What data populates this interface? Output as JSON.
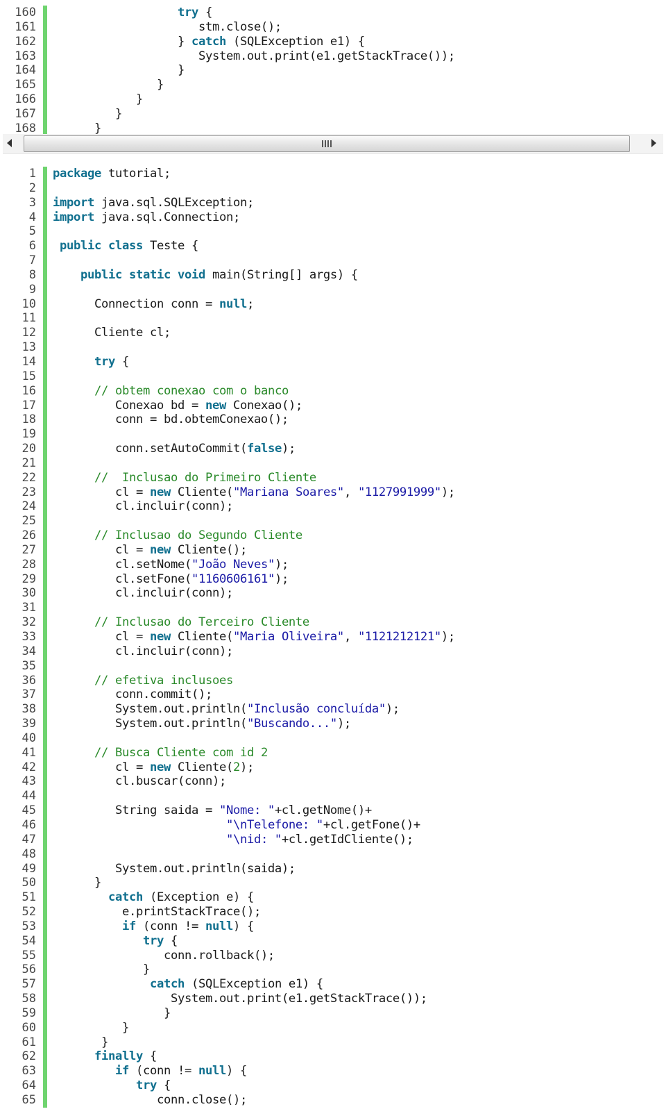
{
  "top_block": {
    "lines": [
      {
        "n": "160",
        "indent": "                  ",
        "tokens": [
          {
            "t": "try",
            "c": "kw"
          },
          {
            "t": " {",
            "c": ""
          }
        ]
      },
      {
        "n": "161",
        "indent": "                     ",
        "tokens": [
          {
            "t": "stm.close();",
            "c": ""
          }
        ]
      },
      {
        "n": "162",
        "indent": "                  ",
        "tokens": [
          {
            "t": "} ",
            "c": ""
          },
          {
            "t": "catch",
            "c": "kw"
          },
          {
            "t": " (SQLException e1) {",
            "c": ""
          }
        ]
      },
      {
        "n": "163",
        "indent": "                     ",
        "tokens": [
          {
            "t": "System.out.print(e1.getStackTrace());",
            "c": ""
          }
        ]
      },
      {
        "n": "164",
        "indent": "                  ",
        "tokens": [
          {
            "t": "}",
            "c": ""
          }
        ]
      },
      {
        "n": "165",
        "indent": "               ",
        "tokens": [
          {
            "t": "}",
            "c": ""
          }
        ]
      },
      {
        "n": "166",
        "indent": "            ",
        "tokens": [
          {
            "t": "}",
            "c": ""
          }
        ]
      },
      {
        "n": "167",
        "indent": "         ",
        "tokens": [
          {
            "t": "}",
            "c": ""
          }
        ]
      },
      {
        "n": "168",
        "indent": "      ",
        "tokens": [
          {
            "t": "}",
            "c": ""
          }
        ]
      }
    ]
  },
  "scrollbar": {
    "left_icon": "arrow-left-icon",
    "right_icon": "arrow-right-icon",
    "grip_icon": "grip-icon",
    "position_fraction": 0.0
  },
  "main_block": {
    "lines": [
      {
        "n": "1",
        "indent": "",
        "tokens": [
          {
            "t": "package",
            "c": "kw"
          },
          {
            "t": " tutorial;",
            "c": ""
          }
        ]
      },
      {
        "n": "2",
        "indent": "",
        "tokens": []
      },
      {
        "n": "3",
        "indent": "",
        "tokens": [
          {
            "t": "import",
            "c": "kw"
          },
          {
            "t": " java.sql.SQLException;",
            "c": ""
          }
        ]
      },
      {
        "n": "4",
        "indent": "",
        "tokens": [
          {
            "t": "import",
            "c": "kw"
          },
          {
            "t": " java.sql.Connection;",
            "c": ""
          }
        ]
      },
      {
        "n": "5",
        "indent": "",
        "tokens": []
      },
      {
        "n": "6",
        "indent": " ",
        "tokens": [
          {
            "t": "public class",
            "c": "kw"
          },
          {
            "t": " Teste {",
            "c": ""
          }
        ]
      },
      {
        "n": "7",
        "indent": "",
        "tokens": []
      },
      {
        "n": "8",
        "indent": "    ",
        "tokens": [
          {
            "t": "public static void",
            "c": "kw"
          },
          {
            "t": " main(String[] args) {",
            "c": ""
          }
        ]
      },
      {
        "n": "9",
        "indent": "",
        "tokens": []
      },
      {
        "n": "10",
        "indent": "      ",
        "tokens": [
          {
            "t": "Connection conn = ",
            "c": ""
          },
          {
            "t": "null",
            "c": "kw"
          },
          {
            "t": ";",
            "c": ""
          }
        ]
      },
      {
        "n": "11",
        "indent": "",
        "tokens": []
      },
      {
        "n": "12",
        "indent": "      ",
        "tokens": [
          {
            "t": "Cliente cl;",
            "c": ""
          }
        ]
      },
      {
        "n": "13",
        "indent": "",
        "tokens": []
      },
      {
        "n": "14",
        "indent": "      ",
        "tokens": [
          {
            "t": "try",
            "c": "kw"
          },
          {
            "t": " {",
            "c": ""
          }
        ]
      },
      {
        "n": "15",
        "indent": "",
        "tokens": []
      },
      {
        "n": "16",
        "indent": "      ",
        "tokens": [
          {
            "t": "// obtem conexao com o banco",
            "c": "cm"
          }
        ]
      },
      {
        "n": "17",
        "indent": "         ",
        "tokens": [
          {
            "t": "Conexao bd = ",
            "c": ""
          },
          {
            "t": "new",
            "c": "kw"
          },
          {
            "t": " Conexao();",
            "c": ""
          }
        ]
      },
      {
        "n": "18",
        "indent": "         ",
        "tokens": [
          {
            "t": "conn = bd.obtemConexao();",
            "c": ""
          }
        ]
      },
      {
        "n": "19",
        "indent": "",
        "tokens": []
      },
      {
        "n": "20",
        "indent": "         ",
        "tokens": [
          {
            "t": "conn.setAutoCommit(",
            "c": ""
          },
          {
            "t": "false",
            "c": "kw"
          },
          {
            "t": ");",
            "c": ""
          }
        ]
      },
      {
        "n": "21",
        "indent": "",
        "tokens": []
      },
      {
        "n": "22",
        "indent": "      ",
        "tokens": [
          {
            "t": "//  Inclusao do Primeiro Cliente",
            "c": "cm"
          }
        ]
      },
      {
        "n": "23",
        "indent": "         ",
        "tokens": [
          {
            "t": "cl = ",
            "c": ""
          },
          {
            "t": "new",
            "c": "kw"
          },
          {
            "t": " Cliente(",
            "c": ""
          },
          {
            "t": "\"Mariana Soares\"",
            "c": "str"
          },
          {
            "t": ", ",
            "c": ""
          },
          {
            "t": "\"1127991999\"",
            "c": "str"
          },
          {
            "t": ");",
            "c": ""
          }
        ]
      },
      {
        "n": "24",
        "indent": "         ",
        "tokens": [
          {
            "t": "cl.incluir(conn);",
            "c": ""
          }
        ]
      },
      {
        "n": "25",
        "indent": "",
        "tokens": []
      },
      {
        "n": "26",
        "indent": "      ",
        "tokens": [
          {
            "t": "// Inclusao do Segundo Cliente",
            "c": "cm"
          }
        ]
      },
      {
        "n": "27",
        "indent": "         ",
        "tokens": [
          {
            "t": "cl = ",
            "c": ""
          },
          {
            "t": "new",
            "c": "kw"
          },
          {
            "t": " Cliente();",
            "c": ""
          }
        ]
      },
      {
        "n": "28",
        "indent": "         ",
        "tokens": [
          {
            "t": "cl.setNome(",
            "c": ""
          },
          {
            "t": "\"João Neves\"",
            "c": "str"
          },
          {
            "t": ");",
            "c": ""
          }
        ]
      },
      {
        "n": "29",
        "indent": "         ",
        "tokens": [
          {
            "t": "cl.setFone(",
            "c": ""
          },
          {
            "t": "\"1160606161\"",
            "c": "str"
          },
          {
            "t": ");",
            "c": ""
          }
        ]
      },
      {
        "n": "30",
        "indent": "         ",
        "tokens": [
          {
            "t": "cl.incluir(conn);",
            "c": ""
          }
        ]
      },
      {
        "n": "31",
        "indent": "",
        "tokens": []
      },
      {
        "n": "32",
        "indent": "      ",
        "tokens": [
          {
            "t": "// Inclusao do Terceiro Cliente",
            "c": "cm"
          }
        ]
      },
      {
        "n": "33",
        "indent": "         ",
        "tokens": [
          {
            "t": "cl = ",
            "c": ""
          },
          {
            "t": "new",
            "c": "kw"
          },
          {
            "t": " Cliente(",
            "c": ""
          },
          {
            "t": "\"Maria Oliveira\"",
            "c": "str"
          },
          {
            "t": ", ",
            "c": ""
          },
          {
            "t": "\"1121212121\"",
            "c": "str"
          },
          {
            "t": ");",
            "c": ""
          }
        ]
      },
      {
        "n": "34",
        "indent": "         ",
        "tokens": [
          {
            "t": "cl.incluir(conn);",
            "c": ""
          }
        ]
      },
      {
        "n": "35",
        "indent": "",
        "tokens": []
      },
      {
        "n": "36",
        "indent": "      ",
        "tokens": [
          {
            "t": "// efetiva inclusoes",
            "c": "cm"
          }
        ]
      },
      {
        "n": "37",
        "indent": "         ",
        "tokens": [
          {
            "t": "conn.commit();",
            "c": ""
          }
        ]
      },
      {
        "n": "38",
        "indent": "         ",
        "tokens": [
          {
            "t": "System.out.println(",
            "c": ""
          },
          {
            "t": "\"Inclusão concluída\"",
            "c": "str"
          },
          {
            "t": ");",
            "c": ""
          }
        ]
      },
      {
        "n": "39",
        "indent": "         ",
        "tokens": [
          {
            "t": "System.out.println(",
            "c": ""
          },
          {
            "t": "\"Buscando...\"",
            "c": "str"
          },
          {
            "t": ");",
            "c": ""
          }
        ]
      },
      {
        "n": "40",
        "indent": "",
        "tokens": []
      },
      {
        "n": "41",
        "indent": "      ",
        "tokens": [
          {
            "t": "// Busca Cliente com id 2",
            "c": "cm"
          }
        ]
      },
      {
        "n": "42",
        "indent": "         ",
        "tokens": [
          {
            "t": "cl = ",
            "c": ""
          },
          {
            "t": "new",
            "c": "kw"
          },
          {
            "t": " Cliente(",
            "c": ""
          },
          {
            "t": "2",
            "c": "num"
          },
          {
            "t": ");",
            "c": ""
          }
        ]
      },
      {
        "n": "43",
        "indent": "         ",
        "tokens": [
          {
            "t": "cl.buscar(conn);",
            "c": ""
          }
        ]
      },
      {
        "n": "44",
        "indent": "",
        "tokens": []
      },
      {
        "n": "45",
        "indent": "         ",
        "tokens": [
          {
            "t": "String saida = ",
            "c": ""
          },
          {
            "t": "\"Nome: \"",
            "c": "str"
          },
          {
            "t": "+cl.getNome()+",
            "c": ""
          }
        ]
      },
      {
        "n": "46",
        "indent": "                         ",
        "tokens": [
          {
            "t": "\"\\nTelefone: \"",
            "c": "str"
          },
          {
            "t": "+cl.getFone()+",
            "c": ""
          }
        ]
      },
      {
        "n": "47",
        "indent": "                         ",
        "tokens": [
          {
            "t": "\"\\nid: \"",
            "c": "str"
          },
          {
            "t": "+cl.getIdCliente();",
            "c": ""
          }
        ]
      },
      {
        "n": "48",
        "indent": "",
        "tokens": []
      },
      {
        "n": "49",
        "indent": "         ",
        "tokens": [
          {
            "t": "System.out.println(saida);",
            "c": ""
          }
        ]
      },
      {
        "n": "50",
        "indent": "      ",
        "tokens": [
          {
            "t": "}",
            "c": ""
          }
        ]
      },
      {
        "n": "51",
        "indent": "        ",
        "tokens": [
          {
            "t": "catch",
            "c": "kw"
          },
          {
            "t": " (Exception e) {",
            "c": ""
          }
        ]
      },
      {
        "n": "52",
        "indent": "          ",
        "tokens": [
          {
            "t": "e.printStackTrace();",
            "c": ""
          }
        ]
      },
      {
        "n": "53",
        "indent": "          ",
        "tokens": [
          {
            "t": "if",
            "c": "kw"
          },
          {
            "t": " (conn != ",
            "c": ""
          },
          {
            "t": "null",
            "c": "kw"
          },
          {
            "t": ") {",
            "c": ""
          }
        ]
      },
      {
        "n": "54",
        "indent": "             ",
        "tokens": [
          {
            "t": "try",
            "c": "kw"
          },
          {
            "t": " {",
            "c": ""
          }
        ]
      },
      {
        "n": "55",
        "indent": "                ",
        "tokens": [
          {
            "t": "conn.rollback();",
            "c": ""
          }
        ]
      },
      {
        "n": "56",
        "indent": "             ",
        "tokens": [
          {
            "t": "}",
            "c": ""
          }
        ]
      },
      {
        "n": "57",
        "indent": "              ",
        "tokens": [
          {
            "t": "catch",
            "c": "kw"
          },
          {
            "t": " (SQLException e1) {",
            "c": ""
          }
        ]
      },
      {
        "n": "58",
        "indent": "                 ",
        "tokens": [
          {
            "t": "System.out.print(e1.getStackTrace());",
            "c": ""
          }
        ]
      },
      {
        "n": "59",
        "indent": "                ",
        "tokens": [
          {
            "t": "}",
            "c": ""
          }
        ]
      },
      {
        "n": "60",
        "indent": "          ",
        "tokens": [
          {
            "t": "}",
            "c": ""
          }
        ]
      },
      {
        "n": "61",
        "indent": "       ",
        "tokens": [
          {
            "t": "}",
            "c": ""
          }
        ]
      },
      {
        "n": "62",
        "indent": "      ",
        "tokens": [
          {
            "t": "finally",
            "c": "kw"
          },
          {
            "t": " {",
            "c": ""
          }
        ]
      },
      {
        "n": "63",
        "indent": "         ",
        "tokens": [
          {
            "t": "if",
            "c": "kw"
          },
          {
            "t": " (conn != ",
            "c": ""
          },
          {
            "t": "null",
            "c": "kw"
          },
          {
            "t": ") {",
            "c": ""
          }
        ]
      },
      {
        "n": "64",
        "indent": "            ",
        "tokens": [
          {
            "t": "try",
            "c": "kw"
          },
          {
            "t": " {",
            "c": ""
          }
        ]
      },
      {
        "n": "65",
        "indent": "               ",
        "tokens": [
          {
            "t": "conn.close();",
            "c": ""
          }
        ]
      }
    ]
  },
  "colors": {
    "keyword": "#11708f",
    "string": "#1a1aa6",
    "comment": "#2a8a2a",
    "gutter_marker": "#6fd46f",
    "line_number": "#4a4a4a"
  }
}
